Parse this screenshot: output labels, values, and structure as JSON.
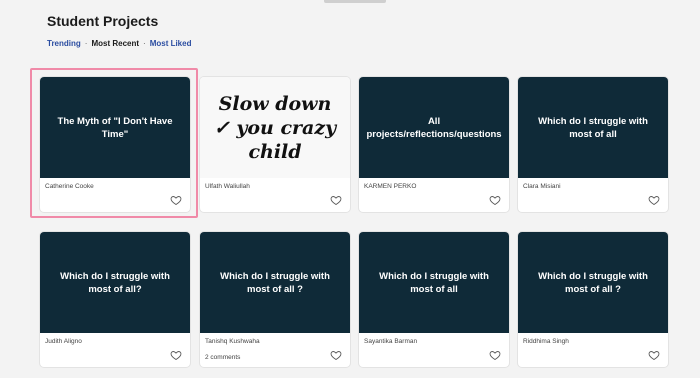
{
  "page": {
    "title": "Student Projects"
  },
  "filters": {
    "trending": "Trending",
    "most_recent": "Most Recent",
    "most_liked": "Most Liked",
    "separator": "·"
  },
  "projects": [
    {
      "thumb_text": "The Myth of \"I Don't Have Time\"",
      "author": "Catherine Cooke",
      "comments": ""
    },
    {
      "thumb_text": "Slow down ✓ you crazy child",
      "author": "Ulfath Waliullah",
      "comments": ""
    },
    {
      "thumb_text": "All projects/reflections/questions",
      "author": "KARMEN PERKO",
      "comments": ""
    },
    {
      "thumb_text": "Which do I struggle with most of all",
      "author": "Clara Misiani",
      "comments": ""
    },
    {
      "thumb_text": "Which do I struggle with most of all?",
      "author": "Judith Aligno",
      "comments": ""
    },
    {
      "thumb_text": "Which do I struggle with most of all ?",
      "author": "Tanishq Kushwaha",
      "comments": "2 comments"
    },
    {
      "thumb_text": "Which do I struggle with most of all",
      "author": "Sayantika Barman",
      "comments": ""
    },
    {
      "thumb_text": "Which do I struggle with most of all ?",
      "author": "Riddhima Singh",
      "comments": ""
    }
  ],
  "colors": {
    "thumb_bg": "#0f2a38",
    "highlight": "#f08aa8",
    "link": "#2b4da1"
  },
  "icons": {
    "like": "heart-icon"
  }
}
